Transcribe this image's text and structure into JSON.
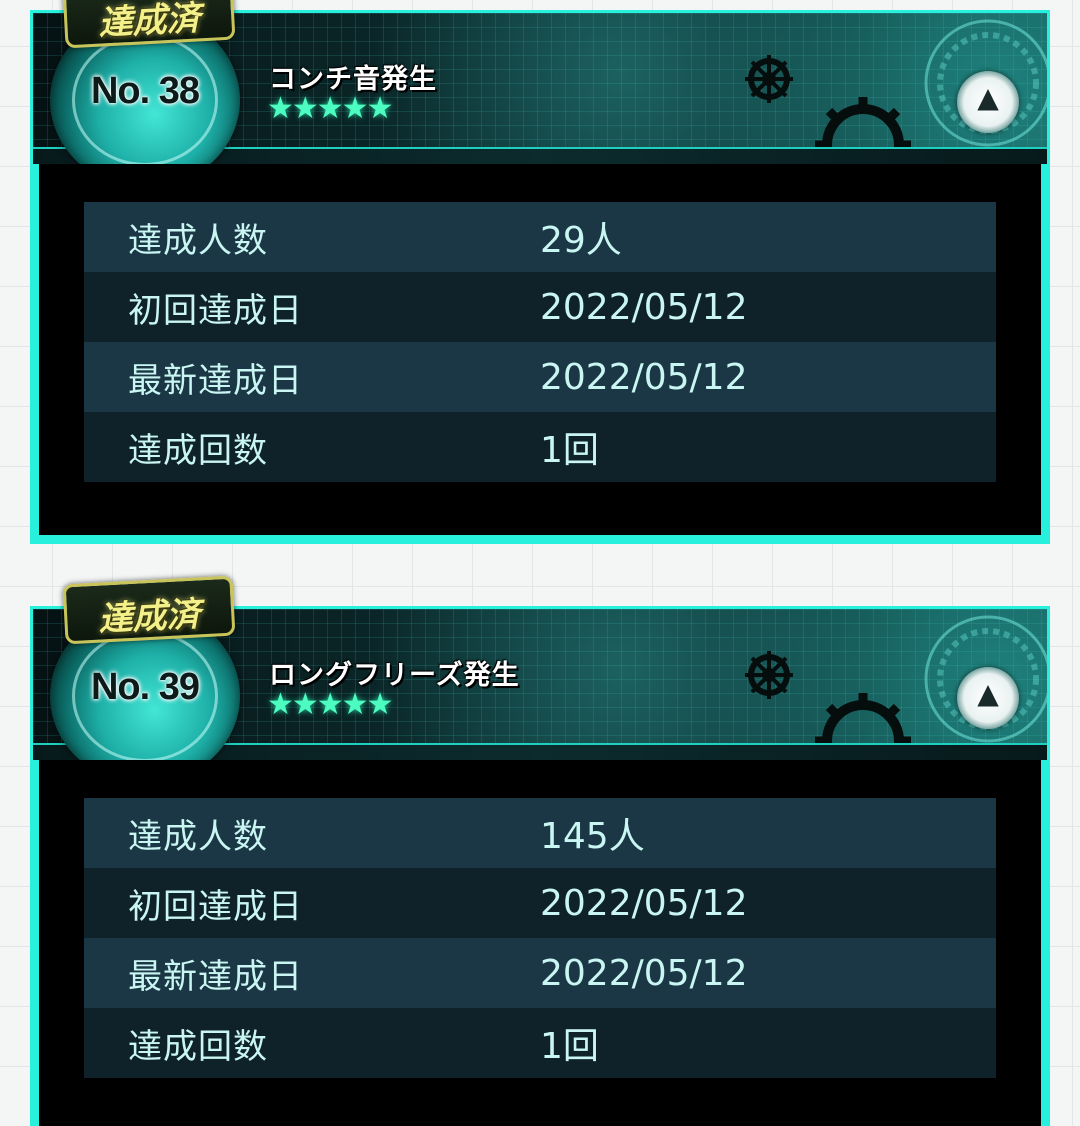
{
  "achievements": [
    {
      "badge": "達成済",
      "number": "No. 38",
      "title": "コンチ音発生",
      "stars": "★★★★★",
      "rating": 5,
      "stats": [
        {
          "label": "達成人数",
          "value": "29人"
        },
        {
          "label": "初回達成日",
          "value": "2022/05/12"
        },
        {
          "label": "最新達成日",
          "value": "2022/05/12"
        },
        {
          "label": "達成回数",
          "value": "1回"
        }
      ]
    },
    {
      "badge": "達成済",
      "number": "No. 39",
      "title": "ロングフリーズ発生",
      "stars": "★★★★★",
      "rating": 5,
      "stats": [
        {
          "label": "達成人数",
          "value": "145人"
        },
        {
          "label": "初回達成日",
          "value": "2022/05/12"
        },
        {
          "label": "最新達成日",
          "value": "2022/05/12"
        },
        {
          "label": "達成回数",
          "value": "1回"
        }
      ]
    }
  ],
  "icons": {
    "toggle": "chevron-up-icon",
    "decoration": "gear-icon"
  },
  "colors": {
    "frame": "#27f0dc",
    "stars": "#4dfcc0",
    "badge_text": "#f3f08a",
    "row_odd": "#1b3745",
    "row_even": "#0f2129",
    "text": "#c9f6f2"
  }
}
